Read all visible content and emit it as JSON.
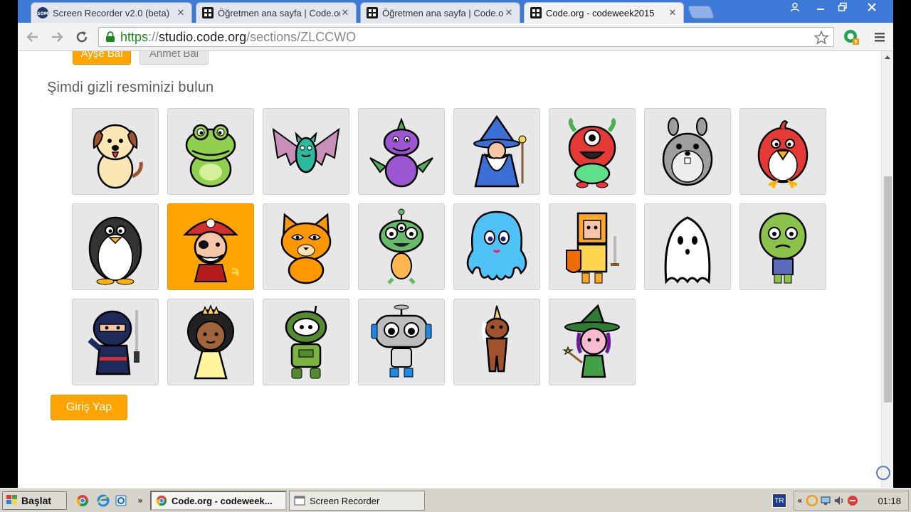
{
  "browser": {
    "tabs": [
      {
        "title": "Screen Recorder v2.0 (beta)",
        "favicon": "som-icon"
      },
      {
        "title": "Öğretmen ana sayfa | Code.org",
        "favicon": "codeorg-icon"
      },
      {
        "title": "Öğretmen ana sayfa | Code.org",
        "favicon": "codeorg-icon"
      },
      {
        "title": "Code.org - codeweek2015",
        "favicon": "codeorg-icon",
        "active": true
      }
    ],
    "url": {
      "scheme": "https",
      "separator": "://",
      "host": "studio.code.org",
      "path": "/sections/ZLCCWO"
    }
  },
  "page": {
    "students": [
      {
        "label": "Ayşe Bal",
        "selected": true
      },
      {
        "label": "Ahmet Bal",
        "selected": false
      }
    ],
    "heading": "Şimdi gizli resminizi bulun",
    "pictures": [
      {
        "name": "dog",
        "selected": false
      },
      {
        "name": "frog",
        "selected": false
      },
      {
        "name": "bat",
        "selected": false
      },
      {
        "name": "dragon",
        "selected": false
      },
      {
        "name": "wizard",
        "selected": false
      },
      {
        "name": "monster",
        "selected": false
      },
      {
        "name": "hamster",
        "selected": false
      },
      {
        "name": "bird",
        "selected": false
      },
      {
        "name": "penguin",
        "selected": false
      },
      {
        "name": "pirate",
        "selected": true
      },
      {
        "name": "cat",
        "selected": false
      },
      {
        "name": "alien",
        "selected": false
      },
      {
        "name": "octopus",
        "selected": false
      },
      {
        "name": "knight",
        "selected": false
      },
      {
        "name": "ghost",
        "selected": false
      },
      {
        "name": "zombie",
        "selected": false
      },
      {
        "name": "ninja",
        "selected": false
      },
      {
        "name": "princess",
        "selected": false
      },
      {
        "name": "robot-green",
        "selected": false
      },
      {
        "name": "robot-grey",
        "selected": false
      },
      {
        "name": "unicorn",
        "selected": false
      },
      {
        "name": "witch",
        "selected": false
      }
    ],
    "submit_label": "Giriş Yap"
  },
  "colors": {
    "accent": "#ffa400",
    "card": "#e7e7e7"
  },
  "taskbar": {
    "start_label": "Başlat",
    "tasks": [
      {
        "label": "Code.org - codeweek...",
        "active": true
      },
      {
        "label": "Screen Recorder",
        "active": false
      }
    ],
    "language": "TR",
    "clock": "01:18"
  }
}
